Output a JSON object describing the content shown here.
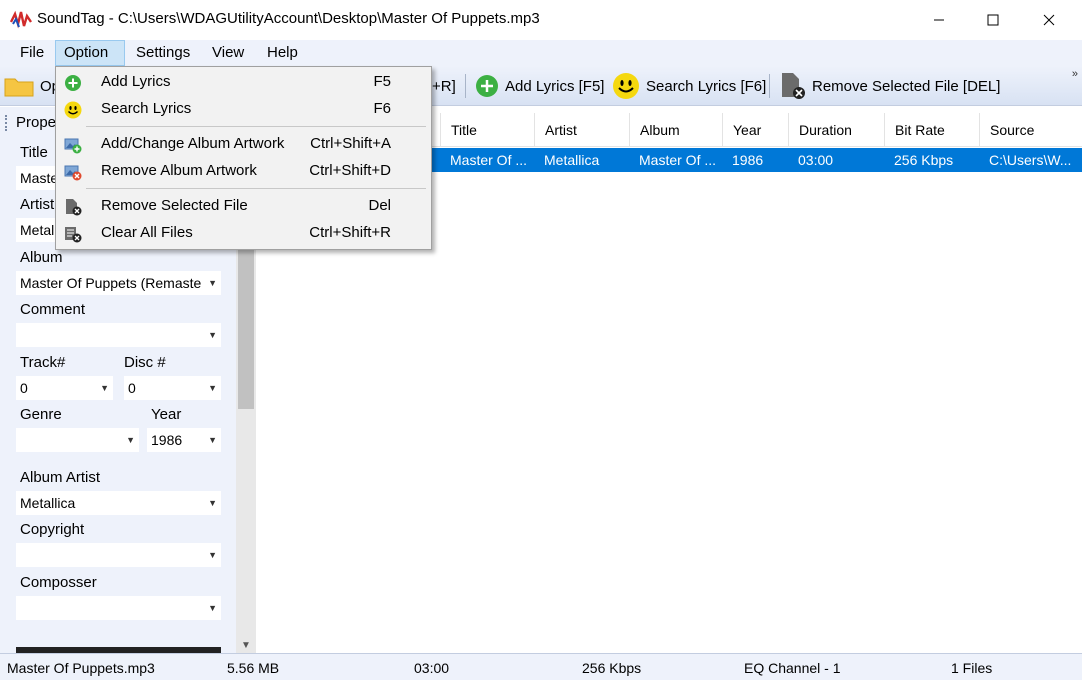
{
  "window": {
    "title": "SoundTag - C:\\Users\\WDAGUtilityAccount\\Desktop\\Master Of Puppets.mp3",
    "minimize_glyph": "—",
    "maximize_glyph": "☐",
    "close_glyph": "✕"
  },
  "menu": {
    "items": [
      {
        "label": "File"
      },
      {
        "label": "Option"
      },
      {
        "label": "Settings"
      },
      {
        "label": "View"
      },
      {
        "label": "Help"
      }
    ]
  },
  "toolbar": {
    "open_label": "Op",
    "clear_label_partial": "+R]",
    "add_lyrics_label": "Add Lyrics [F5]",
    "search_lyrics_label": "Search Lyrics [F6]",
    "remove_label": "Remove Selected File [DEL]",
    "overflow": "»"
  },
  "option_menu": {
    "items": [
      {
        "label": "Add Lyrics",
        "shortcut": "F5",
        "icon": "add-circle-icon"
      },
      {
        "label": "Search Lyrics",
        "shortcut": "F6",
        "icon": "smiley-icon"
      },
      {
        "label": "Add/Change Album Artwork",
        "shortcut": "Ctrl+Shift+A",
        "icon": "image-add-icon"
      },
      {
        "label": "Remove Album Artwork",
        "shortcut": "Ctrl+Shift+D",
        "icon": "image-remove-icon"
      },
      {
        "label": "Remove Selected File",
        "shortcut": "Del",
        "icon": "file-remove-icon"
      },
      {
        "label": "Clear All Files",
        "shortcut": "Ctrl+Shift+R",
        "icon": "list-clear-icon"
      }
    ]
  },
  "properties": {
    "header": "Prope",
    "title_label": "Title",
    "title_value": "Maste",
    "artist_label": "Artist",
    "artist_value": "Metalli",
    "album_label": "Album",
    "album_value": "Master Of Puppets (Remaste",
    "comment_label": "Comment",
    "comment_value": "",
    "track_label": "Track#",
    "track_value": "0",
    "disc_label": "Disc #",
    "disc_value": "0",
    "genre_label": "Genre",
    "genre_value": "",
    "year_label": "Year",
    "year_value": "1986",
    "album_artist_label": "Album Artist",
    "album_artist_value": "Metallica",
    "copyright_label": "Copyright",
    "copyright_value": "",
    "composer_label": "Composser",
    "composer_value": ""
  },
  "file_list": {
    "columns": [
      "Title",
      "Artist",
      "Album",
      "Year",
      "Duration",
      "Bit Rate",
      "Source"
    ],
    "rows": [
      {
        "title": "Master Of ...",
        "artist": "Metallica",
        "album": "Master Of ...",
        "year": "1986",
        "duration": "03:00",
        "bitrate": "256 Kbps",
        "source": "C:\\Users\\W..."
      }
    ]
  },
  "status": {
    "filename": "Master Of Puppets.mp3",
    "size": "5.56 MB",
    "duration": "03:00",
    "bitrate": "256 Kbps",
    "channel": "EQ Channel - 1",
    "count": "1 Files"
  },
  "colors": {
    "selection": "#0078d7",
    "chrome": "#eef2fb",
    "menu_highlight": "#cce4f7",
    "add_green": "#3cb043",
    "smiley_yellow": "#f5d80f"
  }
}
